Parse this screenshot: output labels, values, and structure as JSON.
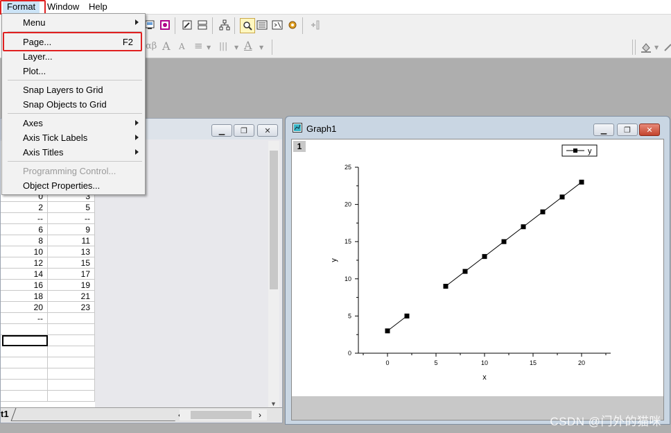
{
  "menubar": {
    "items": [
      "Format",
      "Window",
      "Help"
    ]
  },
  "format_menu": {
    "items": [
      {
        "label": "Menu",
        "shortcut": "",
        "submenu": true,
        "disabled": false
      },
      {
        "label": "Page...",
        "shortcut": "F2",
        "submenu": false,
        "disabled": false
      },
      {
        "label": "Layer...",
        "shortcut": "",
        "submenu": false,
        "disabled": false
      },
      {
        "label": "Plot...",
        "shortcut": "",
        "submenu": false,
        "disabled": false
      },
      {
        "label": "Snap Layers to Grid",
        "shortcut": "",
        "submenu": false,
        "disabled": false
      },
      {
        "label": "Snap Objects to Grid",
        "shortcut": "",
        "submenu": false,
        "disabled": false
      },
      {
        "label": "Axes",
        "shortcut": "",
        "submenu": true,
        "disabled": false
      },
      {
        "label": "Axis Tick Labels",
        "shortcut": "",
        "submenu": true,
        "disabled": false
      },
      {
        "label": "Axis Titles",
        "shortcut": "",
        "submenu": true,
        "disabled": false
      },
      {
        "label": "Programming Control...",
        "shortcut": "",
        "submenu": false,
        "disabled": true
      },
      {
        "label": "Object Properties...",
        "shortcut": "",
        "submenu": false,
        "disabled": false
      }
    ]
  },
  "toolbar": {
    "format_items": [
      "αβ",
      "A",
      "A",
      "≡",
      "|||",
      "A"
    ]
  },
  "worksheet": {
    "rows": [
      [
        "0",
        "3"
      ],
      [
        "2",
        "5"
      ],
      [
        "--",
        "--"
      ],
      [
        "6",
        "9"
      ],
      [
        "8",
        "11"
      ],
      [
        "10",
        "13"
      ],
      [
        "12",
        "15"
      ],
      [
        "14",
        "17"
      ],
      [
        "16",
        "19"
      ],
      [
        "18",
        "21"
      ],
      [
        "20",
        "23"
      ],
      [
        "--",
        ""
      ],
      [
        "",
        ""
      ],
      [
        "",
        ""
      ],
      [
        "",
        ""
      ],
      [
        "",
        ""
      ],
      [
        "",
        ""
      ],
      [
        "",
        ""
      ],
      [
        "",
        ""
      ]
    ],
    "sheet_tab": "t1"
  },
  "graph_window": {
    "title": "Graph1",
    "layer_badge": "1"
  },
  "chart_data": {
    "type": "line",
    "series": [
      {
        "name": "y",
        "segments": [
          [
            [
              0,
              3
            ],
            [
              2,
              5
            ]
          ],
          [
            [
              6,
              9
            ],
            [
              8,
              11
            ],
            [
              10,
              13
            ],
            [
              12,
              15
            ],
            [
              14,
              17
            ],
            [
              16,
              19
            ],
            [
              18,
              21
            ],
            [
              20,
              23
            ]
          ]
        ],
        "color": "#000000",
        "marker": "square"
      }
    ],
    "xlabel": "x",
    "ylabel": "y",
    "xlim": [
      -3,
      23
    ],
    "ylim": [
      0,
      25
    ],
    "xticks": [
      "0",
      "5",
      "10",
      "15",
      "20"
    ],
    "yticks": [
      "0",
      "5",
      "10",
      "15",
      "20",
      "25"
    ],
    "legend": "top-right",
    "grid": false
  },
  "colors": {
    "highlight_box": "#e02020",
    "menu_active": "#cce4f7"
  },
  "watermark": "CSDN @门外的猫咪"
}
